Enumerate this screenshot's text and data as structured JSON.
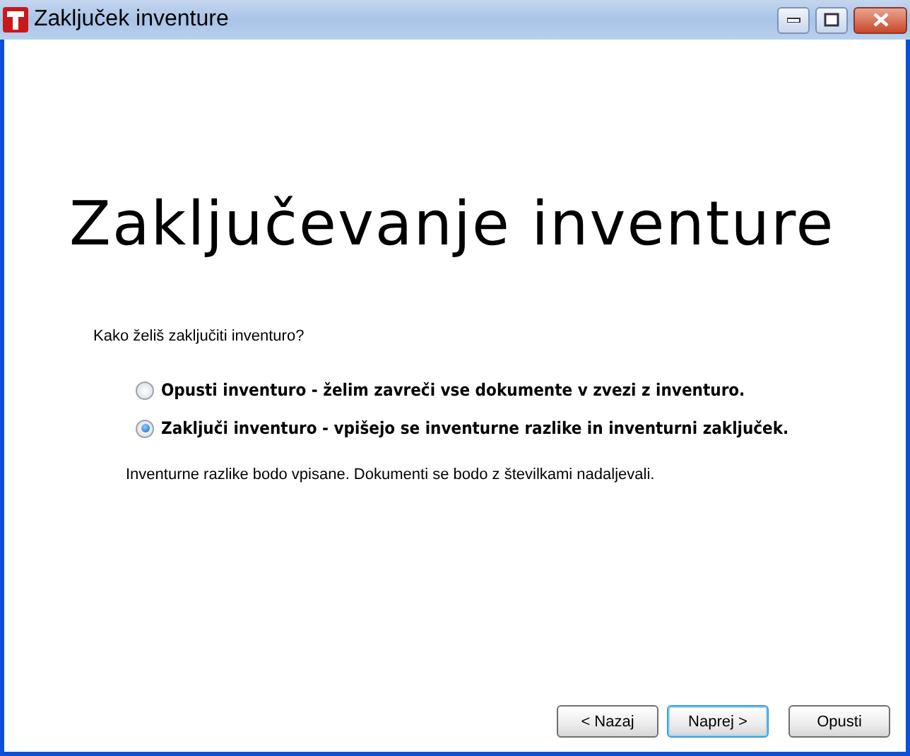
{
  "window": {
    "title": "Zaključek inventure"
  },
  "heading": "Zaključevanje inventure",
  "question": "Kako želiš zaključiti inventuro?",
  "options": [
    {
      "label": "Opusti inventuro - želim zavreči vse dokumente v zvezi z inventuro.",
      "selected": false
    },
    {
      "label": "Zaključi inventuro - vpišejo se inventurne razlike in inventurni zaključek.",
      "selected": true
    }
  ],
  "note": "Inventurne razlike bodo vpisane. Dokumenti se bodo z številkami nadaljevali.",
  "buttons": [
    {
      "label": "< Nazaj",
      "default": false
    },
    {
      "label": "Naprej >",
      "default": true
    },
    {
      "label": "Opusti",
      "default": false
    }
  ]
}
